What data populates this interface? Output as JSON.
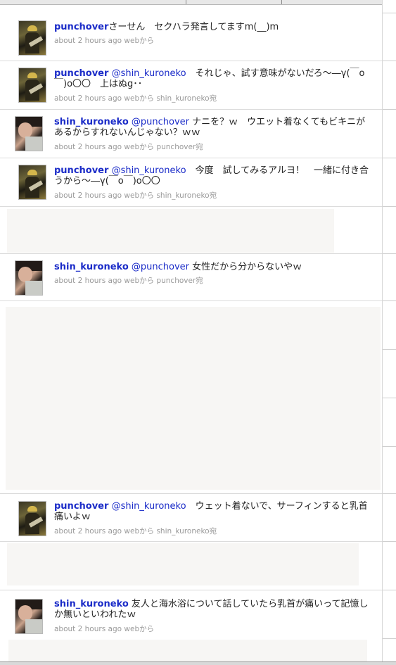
{
  "tweets": [
    {
      "user": "punchover",
      "mention": "",
      "text": "さーせん　セクハラ発言してますm(__)m",
      "time": "about 2 hours ago",
      "source": "webから",
      "reply_to": ""
    },
    {
      "user": "punchover",
      "mention": "@shin_kuroneko",
      "text": "　それじゃ、試す意味がないだろ〜―γ(￣o￣)o〇〇　上はぬg･･",
      "time": "about 2 hours ago",
      "source": "webから",
      "reply_to": "shin_kuroneko宛"
    },
    {
      "user": "shin_kuroneko",
      "mention": "@punchover",
      "text": " ナニを？ｗ　ウエット着なくてもビキニがあるからすれないんじゃない？ｗｗ",
      "time": "about 2 hours ago",
      "source": "webから",
      "reply_to": "punchover宛"
    },
    {
      "user": "punchover",
      "mention": "@shin_kuroneko",
      "text": "　今度　試してみるアルヨ！　一緒に付き合うから〜―γ(￣o￣)o〇〇",
      "time": "about 2 hours ago",
      "source": "webから",
      "reply_to": "shin_kuroneko宛"
    },
    {
      "user": "shin_kuroneko",
      "mention": "@punchover",
      "text": " 女性だから分からないやｗ",
      "time": "about 2 hours ago",
      "source": "webから",
      "reply_to": "punchover宛"
    },
    {
      "user": "punchover",
      "mention": "@shin_kuroneko",
      "text": "　ウェット着ないで、サーフィンすると乳首痛いよｗ",
      "time": "about 2 hours ago",
      "source": "webから",
      "reply_to": "shin_kuroneko宛"
    },
    {
      "user": "shin_kuroneko",
      "mention": "",
      "text": "友人と海水浴について話していたら乳首が痛いって記憶しか無いといわれたｗ",
      "time": "about 2 hours ago",
      "source": "webから",
      "reply_to": ""
    }
  ]
}
